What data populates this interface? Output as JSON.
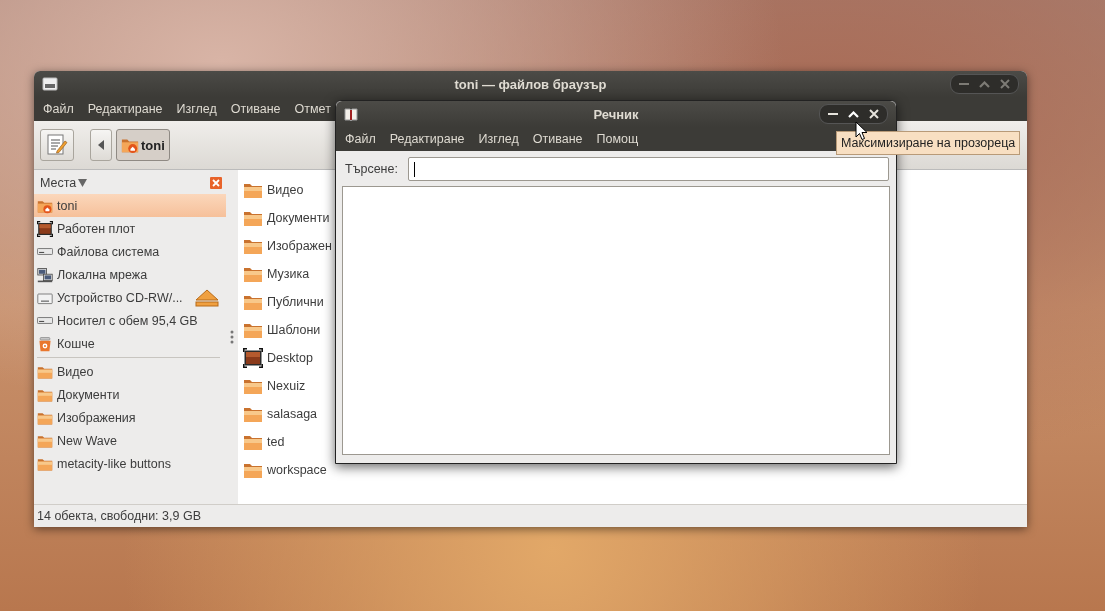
{
  "file_browser": {
    "title": "toni — файлов браузър",
    "menu": [
      "Файл",
      "Редактиране",
      "Изглед",
      "Отиване",
      "Отмет"
    ],
    "path_buttons": [
      {
        "label": "toni",
        "selected": true
      }
    ],
    "sidebar": {
      "title": "Места",
      "places": [
        {
          "label": "toni",
          "kind": "home",
          "selected": true
        },
        {
          "label": "Работен плот",
          "kind": "desktop",
          "selected": false
        },
        {
          "label": "Файлова система",
          "kind": "drive",
          "selected": false
        },
        {
          "label": "Локална мрежа",
          "kind": "network",
          "selected": false
        },
        {
          "label": "Устройство CD-RW/...",
          "kind": "optical",
          "selected": false
        },
        {
          "label": "Носител с обем 95,4 GB",
          "kind": "drive",
          "selected": false
        },
        {
          "label": "Кошче",
          "kind": "trash",
          "selected": false
        }
      ],
      "bookmarks": [
        {
          "label": "Видео",
          "selected": false
        },
        {
          "label": "Документи",
          "selected": false
        },
        {
          "label": "Изображения",
          "selected": false
        },
        {
          "label": "New Wave",
          "selected": false
        },
        {
          "label": "metacity-like buttons",
          "selected": false
        }
      ]
    },
    "files": [
      {
        "name": "Видео",
        "kind": "folder"
      },
      {
        "name": "Документи",
        "kind": "folder"
      },
      {
        "name": "Изображен",
        "kind": "folder"
      },
      {
        "name": "Музика",
        "kind": "folder"
      },
      {
        "name": "Публични",
        "kind": "folder"
      },
      {
        "name": "Шаблони",
        "kind": "folder"
      },
      {
        "name": "Desktop",
        "kind": "desktop"
      },
      {
        "name": "Nexuiz",
        "kind": "folder"
      },
      {
        "name": "salasaga",
        "kind": "folder"
      },
      {
        "name": "ted",
        "kind": "folder"
      },
      {
        "name": "workspace",
        "kind": "folder"
      }
    ],
    "status_bar": "14 обекта, свободни: 3,9 GB"
  },
  "dictionary": {
    "title": "Речник",
    "menu": [
      "Файл",
      "Редактиране",
      "Изглед",
      "Отиване",
      "Помощ"
    ],
    "search": {
      "label": "Търсене:"
    }
  },
  "tooltip": "Максимизиране на прозореца"
}
